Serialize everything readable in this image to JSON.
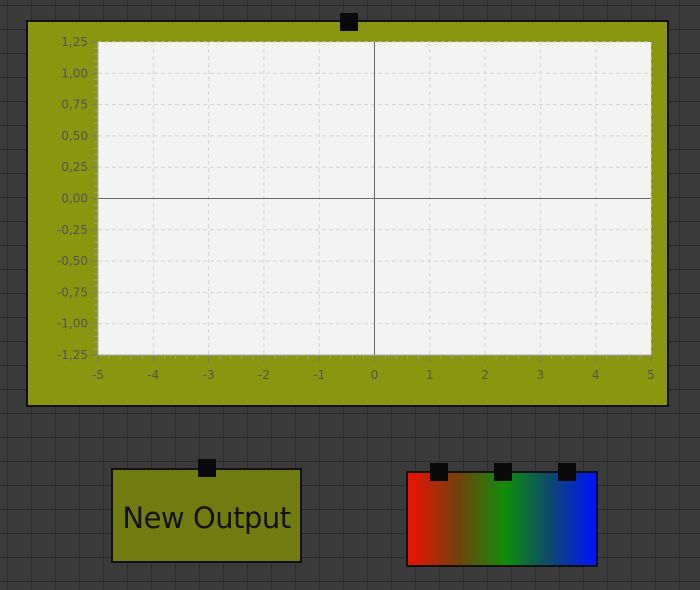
{
  "graph_node": {
    "chart_data": {
      "type": "line",
      "x_ticks": [
        "-5",
        "-4",
        "-3",
        "-2",
        "-1",
        "0",
        "1",
        "2",
        "3",
        "4",
        "5"
      ],
      "y_ticks": [
        "1,25",
        "1,00",
        "0,75",
        "0,50",
        "0,25",
        "0,00",
        "-0,25",
        "-0,50",
        "-0,75",
        "-1,00",
        "-1,25"
      ],
      "xlim": [
        -5,
        5
      ],
      "ylim": [
        -1.25,
        1.25
      ],
      "grid": true,
      "series": []
    }
  },
  "output_node": {
    "label": "New Output"
  },
  "colors": {
    "graph_node_bg": "#8a9610",
    "output_node_bg": "#717c10",
    "plot_bg": "#f3f3f3",
    "gradient_stops": [
      "#ee1100",
      "#0e8d0a",
      "#0011ff"
    ]
  }
}
